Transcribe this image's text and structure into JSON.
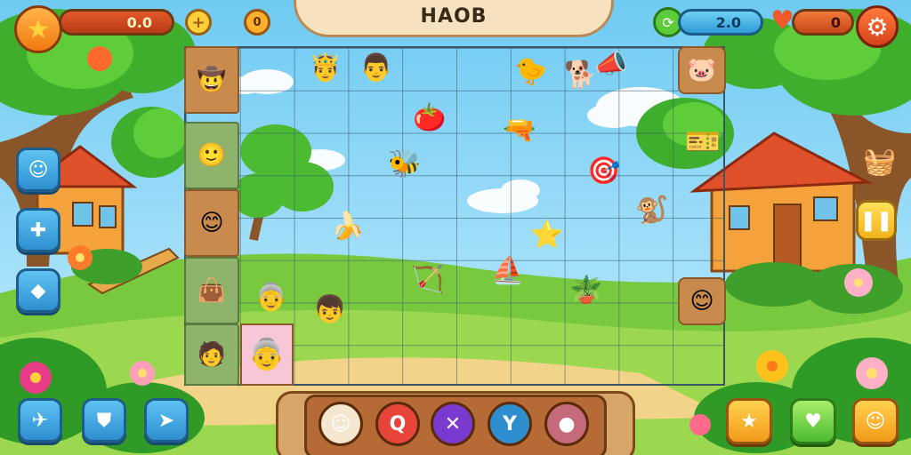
{
  "title": "HAOB",
  "hud": {
    "star_score": "0.0",
    "coins": "0",
    "gems": "2.0",
    "lives": "0"
  },
  "colors": {
    "sky": "#9fdcf5",
    "grass": "#8fd24a",
    "wood": "#c98a4e",
    "accent_orange": "#f29a1a",
    "accent_blue": "#2e8fd0"
  },
  "left_tiles": [
    {
      "icon": "cowboy-face",
      "glyph": "🤠",
      "tint": "wood"
    },
    {
      "icon": "smiley-face",
      "glyph": "🙂",
      "tint": "green"
    },
    {
      "icon": "hat-face",
      "glyph": "😊",
      "tint": "wood"
    },
    {
      "icon": "sack",
      "glyph": "👜",
      "tint": "green"
    },
    {
      "icon": "explorer-face",
      "glyph": "🧑",
      "tint": "green"
    }
  ],
  "right_tiles": [
    {
      "icon": "pig-face",
      "glyph": "🐷"
    },
    {
      "icon": "smiley-coin",
      "glyph": "😊"
    }
  ],
  "grid_items": [
    {
      "icon": "crowned-face",
      "glyph": "🤴"
    },
    {
      "icon": "hat-man-face",
      "glyph": "👨"
    },
    {
      "icon": "duck",
      "glyph": "🐤"
    },
    {
      "icon": "dog",
      "glyph": "🐕"
    },
    {
      "icon": "megaphone",
      "glyph": "📣"
    },
    {
      "icon": "tomato",
      "glyph": "🍅"
    },
    {
      "icon": "water-gun",
      "glyph": "🔫"
    },
    {
      "icon": "bee",
      "glyph": "🐝"
    },
    {
      "icon": "cannon",
      "glyph": "🎯"
    },
    {
      "icon": "monkey",
      "glyph": "🐒"
    },
    {
      "icon": "banana-creature",
      "glyph": "🍌"
    },
    {
      "icon": "starfish",
      "glyph": "⭐"
    },
    {
      "icon": "sail",
      "glyph": "⛵"
    },
    {
      "icon": "plant-pot",
      "glyph": "🪴"
    },
    {
      "icon": "little-man",
      "glyph": "👦"
    },
    {
      "icon": "granny-face",
      "glyph": "👵"
    },
    {
      "icon": "catapult",
      "glyph": "🏹"
    }
  ],
  "left_buttons": [
    "face-icon",
    "puzzle-icon",
    "candy-icon"
  ],
  "bottom_left_buttons": [
    "bird-icon",
    "shirt-icon",
    "cursor-icon"
  ],
  "tray_items": [
    {
      "icon": "ghost-face",
      "glyph": "☺"
    },
    {
      "icon": "target-q",
      "glyph": "Q"
    },
    {
      "icon": "cross",
      "glyph": "✕"
    },
    {
      "icon": "wrench",
      "glyph": "Y"
    },
    {
      "icon": "egg",
      "glyph": "●"
    }
  ],
  "bottom_right_buttons": [
    "star-icon",
    "heart-icon",
    "face-icon"
  ]
}
